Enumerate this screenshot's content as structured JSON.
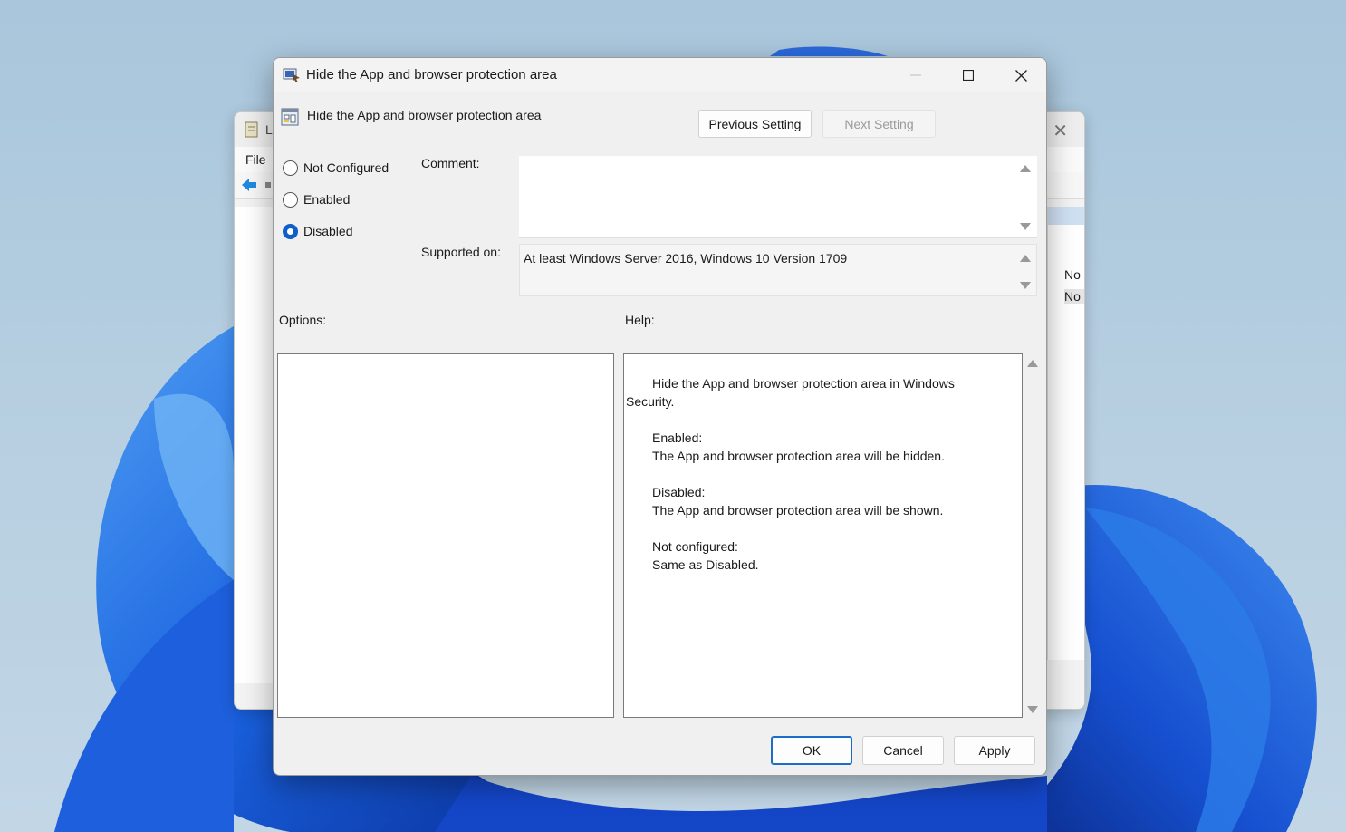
{
  "background_window": {
    "title": "L",
    "menu_file": "File",
    "rows": [
      "No",
      "No"
    ]
  },
  "dialog": {
    "title": "Hide the App and browser protection area",
    "header_text": "Hide the App and browser protection area",
    "previous_setting_label": "Previous Setting",
    "next_setting_label": "Next Setting",
    "radios": [
      {
        "label": "Not Configured",
        "checked": false
      },
      {
        "label": "Enabled",
        "checked": false
      },
      {
        "label": "Disabled",
        "checked": true
      }
    ],
    "comment_label": "Comment:",
    "comment_value": "",
    "supported_label": "Supported on:",
    "supported_value": "At least Windows Server 2016, Windows 10 Version 1709",
    "options_label": "Options:",
    "help_label": "Help:",
    "help": {
      "intro_line1": "Hide the App and browser protection area in Windows",
      "intro_line2": "Security.",
      "enabled_heading": "Enabled:",
      "enabled_text": "The App and browser protection area will be hidden.",
      "disabled_heading": "Disabled:",
      "disabled_text": "The App and browser protection area will be shown.",
      "notconfigured_heading": "Not configured:",
      "notconfigured_text": "Same as Disabled."
    },
    "ok_label": "OK",
    "cancel_label": "Cancel",
    "apply_label": "Apply"
  },
  "colors": {
    "accent": "#0f5fc9",
    "wallpaper_blue": "#1a5fe0"
  }
}
